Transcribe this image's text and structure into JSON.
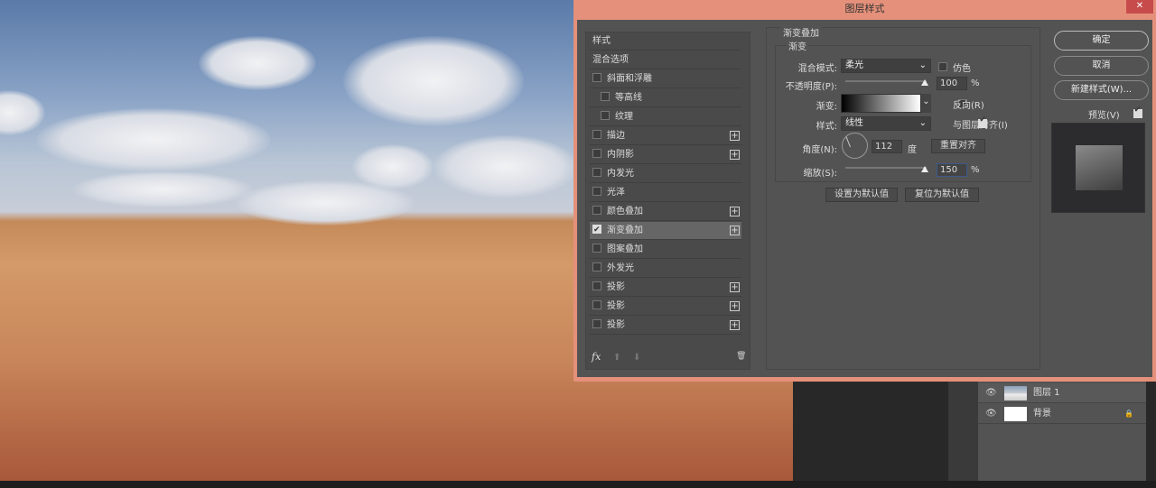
{
  "dialog": {
    "title": "图层样式",
    "close": "✕"
  },
  "styles_list": {
    "header": "样式",
    "items": [
      {
        "label": "混合选项",
        "checkbox": false,
        "checked": false,
        "plus": false,
        "indent": false
      },
      {
        "label": "斜面和浮雕",
        "checkbox": true,
        "checked": false,
        "plus": false,
        "indent": false
      },
      {
        "label": "等高线",
        "checkbox": true,
        "checked": false,
        "plus": false,
        "indent": true
      },
      {
        "label": "纹理",
        "checkbox": true,
        "checked": false,
        "plus": false,
        "indent": true
      },
      {
        "label": "描边",
        "checkbox": true,
        "checked": false,
        "plus": true,
        "indent": false
      },
      {
        "label": "内阴影",
        "checkbox": true,
        "checked": false,
        "plus": true,
        "indent": false
      },
      {
        "label": "内发光",
        "checkbox": true,
        "checked": false,
        "plus": false,
        "indent": false
      },
      {
        "label": "光泽",
        "checkbox": true,
        "checked": false,
        "plus": false,
        "indent": false
      },
      {
        "label": "颜色叠加",
        "checkbox": true,
        "checked": false,
        "plus": true,
        "indent": false
      },
      {
        "label": "渐变叠加",
        "checkbox": true,
        "checked": true,
        "plus": true,
        "indent": false,
        "selected": true
      },
      {
        "label": "图案叠加",
        "checkbox": true,
        "checked": false,
        "plus": false,
        "indent": false
      },
      {
        "label": "外发光",
        "checkbox": true,
        "checked": false,
        "plus": false,
        "indent": false
      },
      {
        "label": "投影",
        "checkbox": true,
        "checked": false,
        "plus": true,
        "indent": false
      },
      {
        "label": "投影",
        "checkbox": true,
        "checked": false,
        "plus": true,
        "indent": false
      },
      {
        "label": "投影",
        "checkbox": true,
        "checked": false,
        "plus": true,
        "indent": false
      }
    ],
    "footer": {
      "fx": "fx",
      "up": "⬆",
      "down": "⬇",
      "trash": "🗑"
    }
  },
  "gradient_overlay": {
    "group_title": "渐变叠加",
    "sub_title": "渐变",
    "blend_mode_label": "混合模式:",
    "blend_mode": "柔光",
    "dither_label": "仿色",
    "opacity_label": "不透明度(P):",
    "opacity": "100",
    "opacity_unit": "%",
    "gradient_label": "渐变:",
    "reverse_label": "反向(R)",
    "style_label": "样式:",
    "style": "线性",
    "align_label": "与图层对齐(I)",
    "angle_label": "角度(N):",
    "angle": "112",
    "angle_unit": "度",
    "reset_align": "重置对齐",
    "scale_label": "缩放(S):",
    "scale": "150",
    "scale_unit": "%",
    "set_default": "设置为默认值",
    "reset_default": "复位为默认值"
  },
  "buttons": {
    "ok": "确定",
    "cancel": "取消",
    "new_style": "新建样式(W)...",
    "preview": "预览(V)"
  },
  "layers": [
    {
      "name": "图层 1"
    },
    {
      "name": "背景",
      "lock": "🔒"
    }
  ]
}
